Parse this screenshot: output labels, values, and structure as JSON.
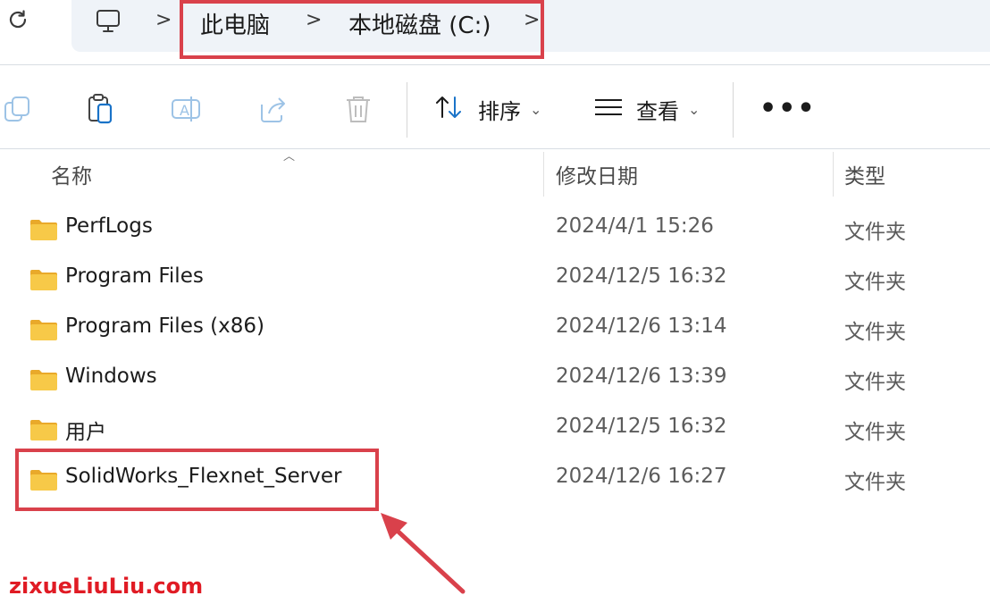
{
  "address_bar": {
    "breadcrumb": [
      "此电脑",
      "本地磁盘 (C:)"
    ],
    "separator": ">"
  },
  "toolbar": {
    "icons": [
      "copy-icon",
      "paste-icon",
      "rename-icon",
      "share-icon",
      "delete-icon"
    ],
    "sort_label": "排序",
    "view_label": "查看",
    "more_label": "•••"
  },
  "columns": {
    "name": "名称",
    "modified": "修改日期",
    "type": "类型"
  },
  "files": [
    {
      "name": "PerfLogs",
      "modified": "2024/4/1 15:26",
      "type": "文件夹"
    },
    {
      "name": "Program Files",
      "modified": "2024/12/5 16:32",
      "type": "文件夹"
    },
    {
      "name": "Program Files (x86)",
      "modified": "2024/12/6 13:14",
      "type": "文件夹"
    },
    {
      "name": "Windows",
      "modified": "2024/12/6 13:39",
      "type": "文件夹"
    },
    {
      "name": "用户",
      "modified": "2024/12/5 16:32",
      "type": "文件夹"
    },
    {
      "name": "SolidWorks_Flexnet_Server",
      "modified": "2024/12/6 16:27",
      "type": "文件夹"
    }
  ],
  "watermark": "zixueLiuLiu.com",
  "colors": {
    "highlight": "#d9414b",
    "folder": "#f7c948",
    "watermark": "#e01b24"
  }
}
